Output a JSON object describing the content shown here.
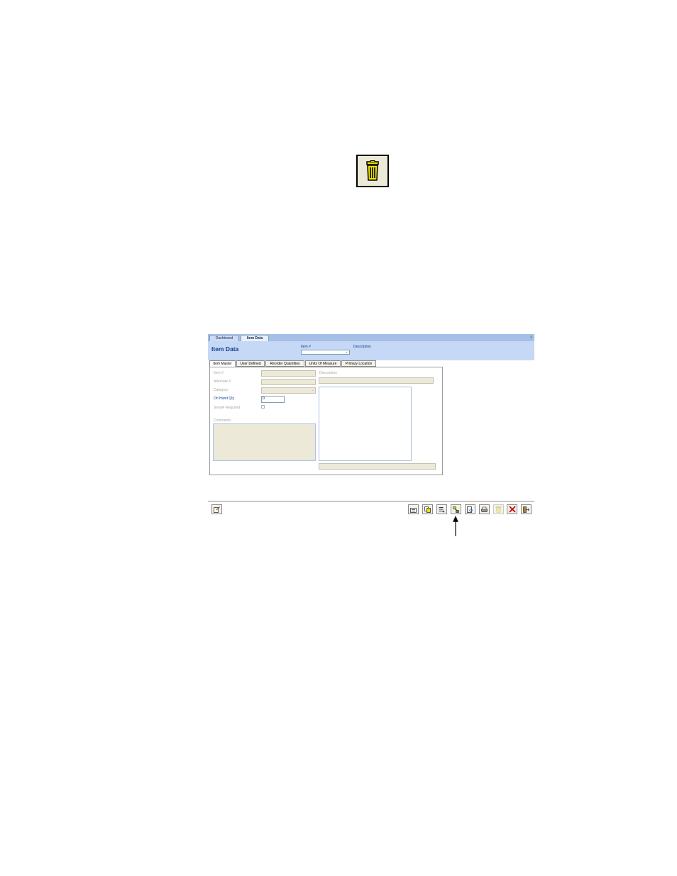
{
  "window": {
    "tabs": [
      {
        "label": "Dashboard"
      },
      {
        "label": "Item Data"
      }
    ],
    "close_glyph": "x"
  },
  "header": {
    "title": "Item Data",
    "item_label": "Item #",
    "description_label": "Description",
    "item_value": ""
  },
  "form_tabs": [
    {
      "label": "Item Master",
      "active": true
    },
    {
      "label": "User Defined"
    },
    {
      "label": "Reorder Quantities"
    },
    {
      "label": "Units Of Measure"
    },
    {
      "label": "Primary Location"
    }
  ],
  "form": {
    "item_no_label": "Item #",
    "alternate_label": "Alternate #",
    "category_label": "Category",
    "on_hand_qty_label": "On Hand Qty",
    "on_hand_qty_value": "0",
    "serial_required_label": "Serial# Required",
    "comments_label": "Comments",
    "description_label": "Description"
  },
  "toolbar": {
    "left_button": "edit-icon",
    "right_buttons": [
      "new-record-icon",
      "copy-icon",
      "list-icon",
      "link-icon",
      "preview-icon",
      "print-icon",
      "delete-icon",
      "close-red-icon",
      "exit-icon"
    ],
    "disabled_button": "delete-icon"
  },
  "callout": {
    "icon": "trash-can-icon",
    "arrow_target": "link-icon"
  },
  "colors": {
    "header_bg": "#c5d8f5",
    "tabstrip_bg": "#a5bfe6",
    "title_text": "#15428b",
    "disabled_field": "#ece9d8",
    "trash_yellow": "#e8e000"
  }
}
